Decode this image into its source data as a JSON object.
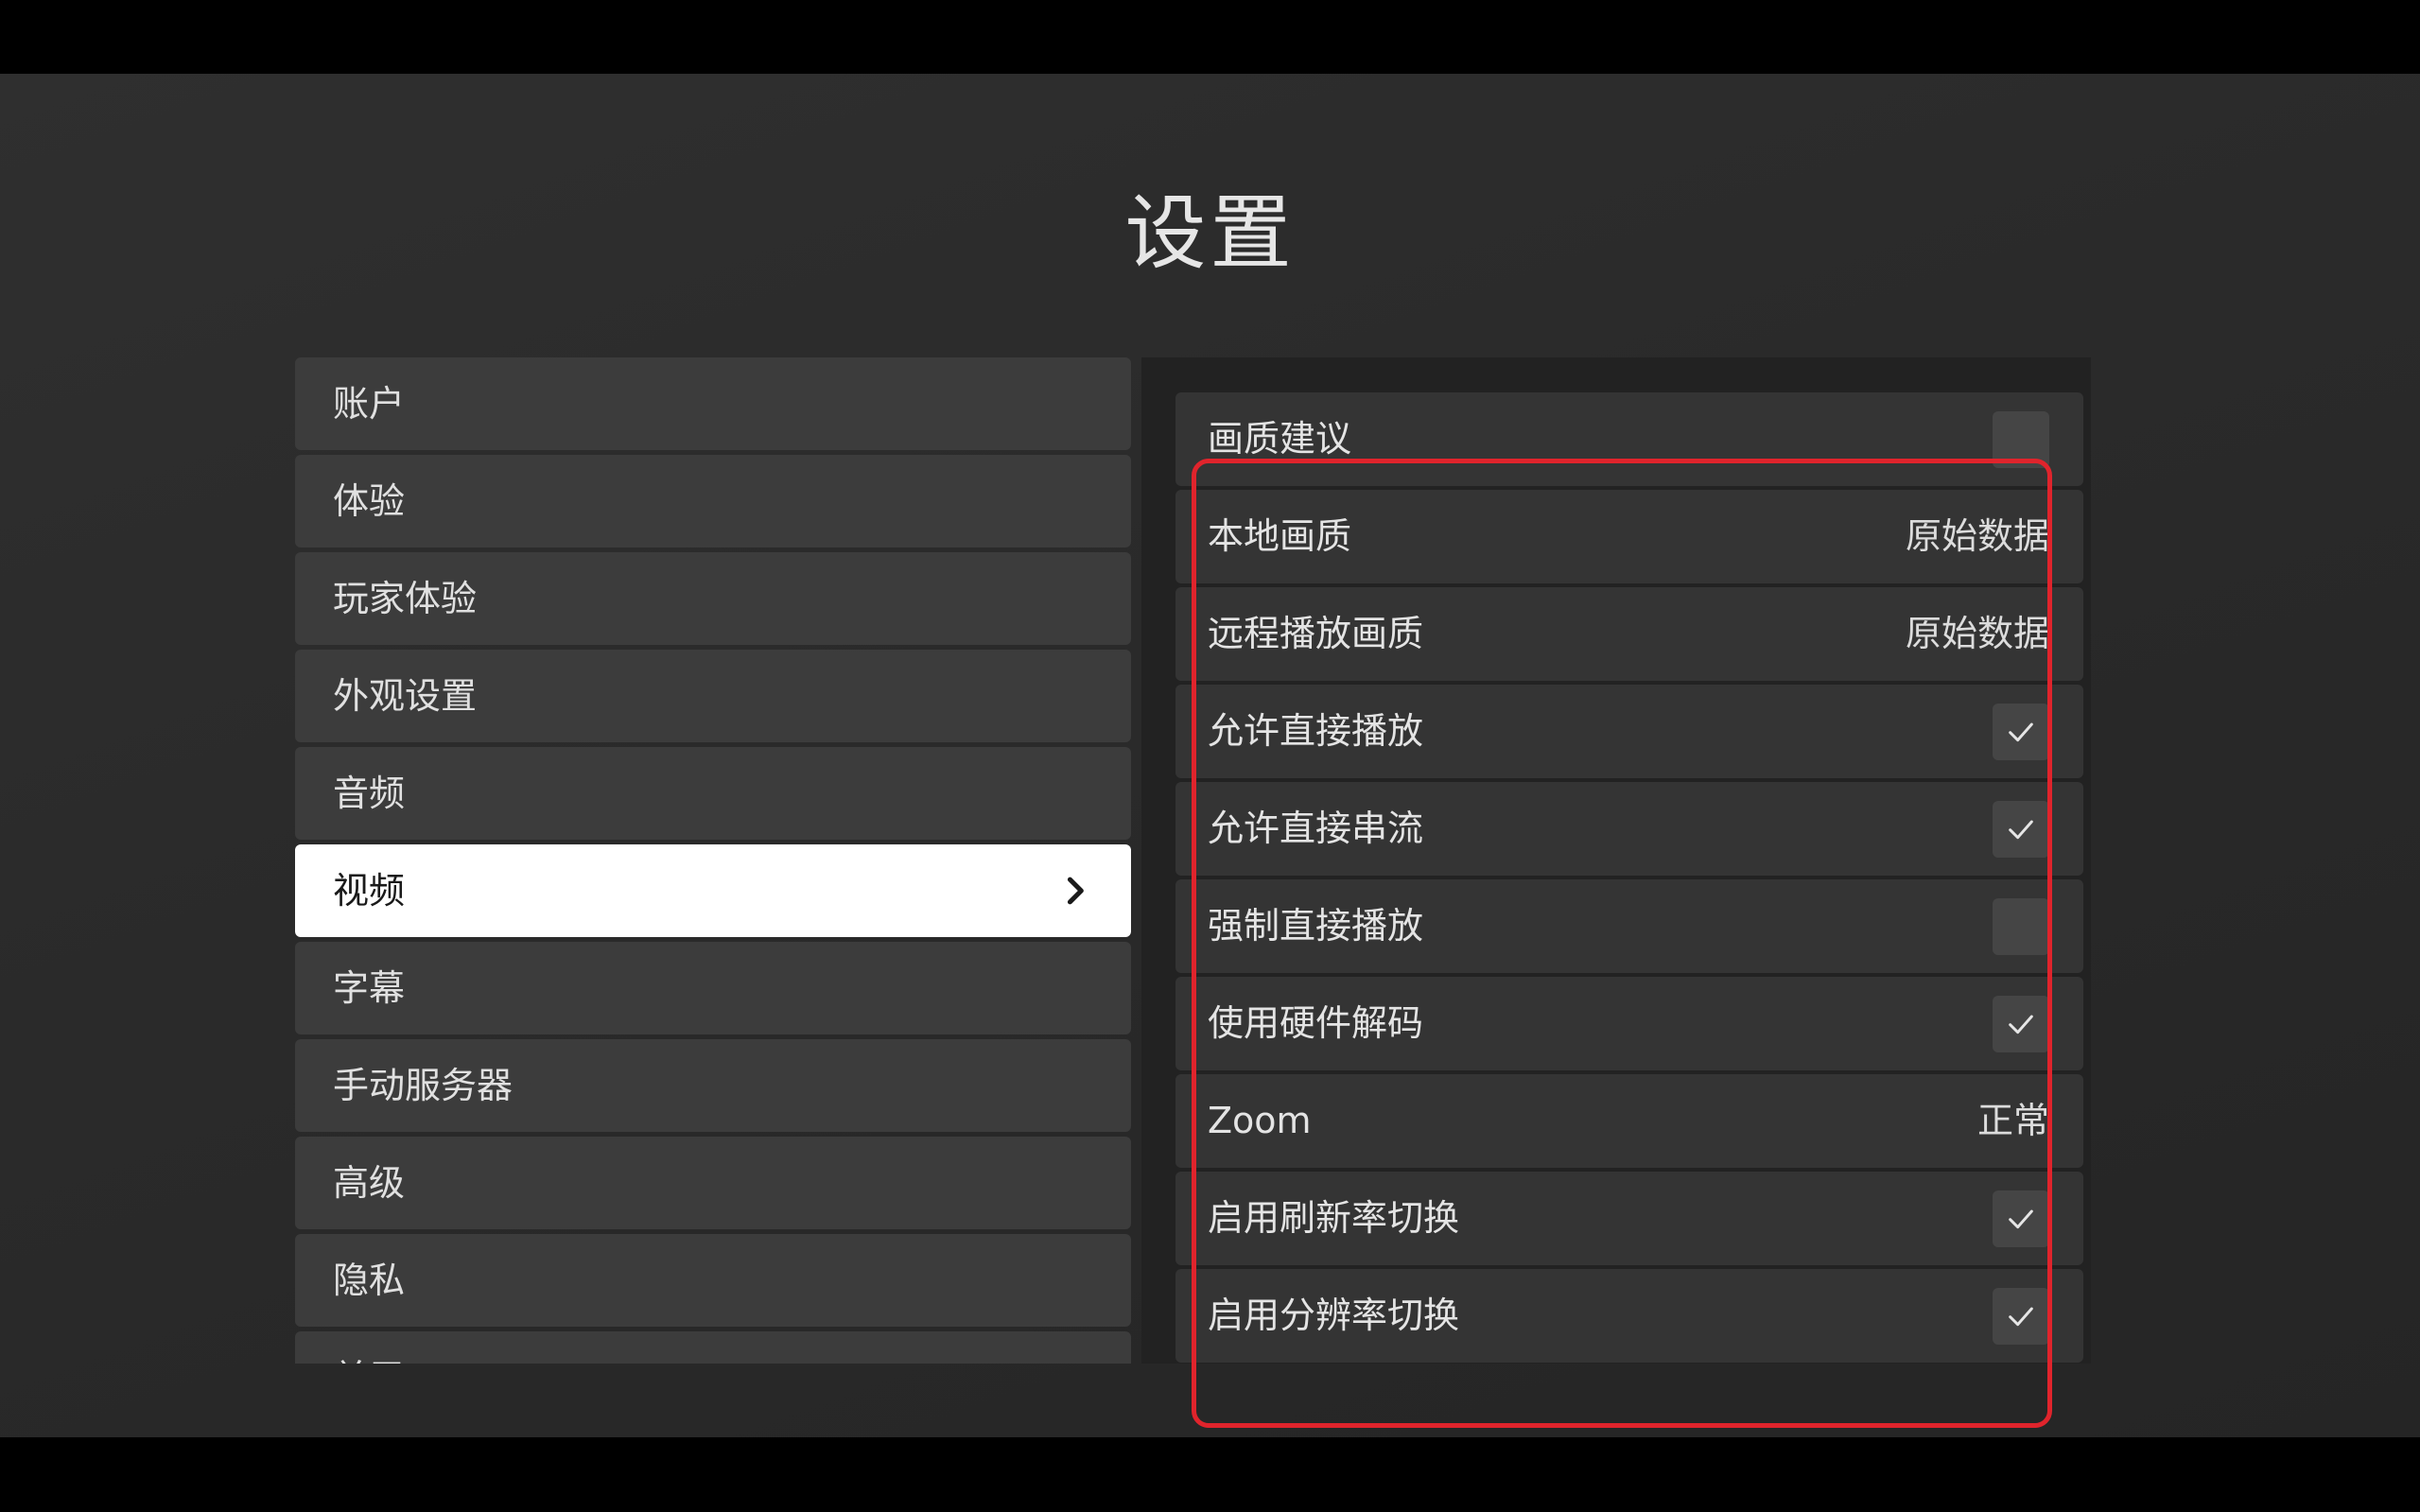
{
  "page": {
    "title": "设置"
  },
  "sidebar": {
    "items": [
      {
        "label": "账户"
      },
      {
        "label": "体验"
      },
      {
        "label": "玩家体验"
      },
      {
        "label": "外观设置"
      },
      {
        "label": "音频"
      },
      {
        "label": "视频",
        "selected": true
      },
      {
        "label": "字幕"
      },
      {
        "label": "手动服务器"
      },
      {
        "label": "高级"
      },
      {
        "label": "隐私"
      },
      {
        "label": "关于"
      }
    ]
  },
  "video_settings": {
    "rows": [
      {
        "label": "画质建议",
        "type": "checkbox",
        "checked": false
      },
      {
        "label": "本地画质",
        "type": "value",
        "value": "原始数据"
      },
      {
        "label": "远程播放画质",
        "type": "value",
        "value": "原始数据"
      },
      {
        "label": "允许直接播放",
        "type": "checkbox",
        "checked": true
      },
      {
        "label": "允许直接串流",
        "type": "checkbox",
        "checked": true
      },
      {
        "label": "强制直接播放",
        "type": "checkbox",
        "checked": false
      },
      {
        "label": "使用硬件解码",
        "type": "checkbox",
        "checked": true
      },
      {
        "label": "Zoom",
        "type": "value",
        "value": "正常"
      },
      {
        "label": "启用刷新率切换",
        "type": "checkbox",
        "checked": true
      },
      {
        "label": "启用分辨率切换",
        "type": "checkbox",
        "checked": true
      }
    ]
  },
  "icons": {
    "selected_chevron": "chevron-right-icon",
    "checkbox_check": "checkmark-icon"
  },
  "colors": {
    "highlight": "#e0242c",
    "selected_background": "#ffffff"
  }
}
